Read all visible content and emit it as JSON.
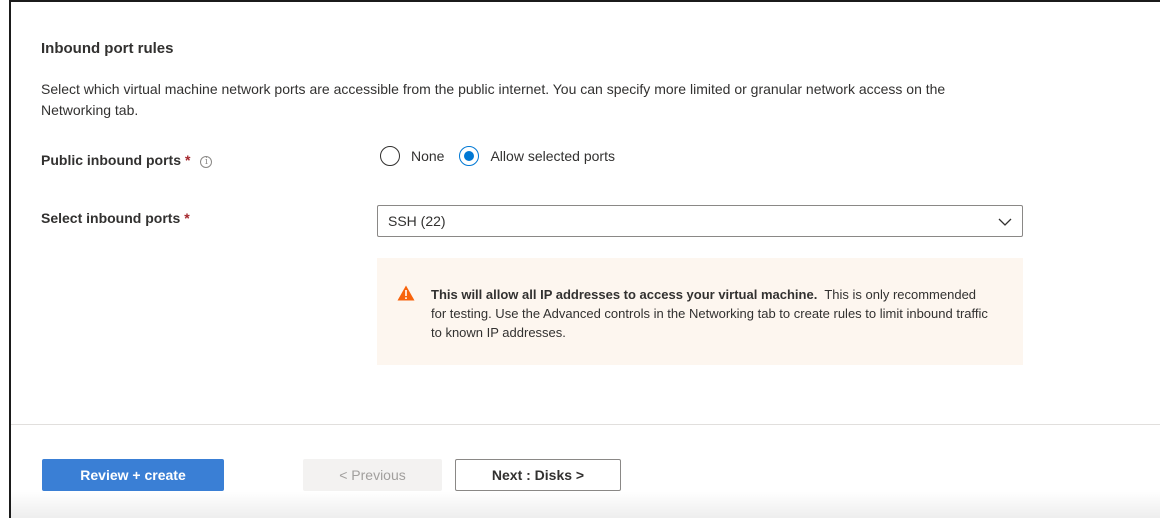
{
  "section": {
    "title": "Inbound port rules",
    "description": "Select which virtual machine network ports are accessible from the public internet. You can specify more limited or granular network access on the Networking tab."
  },
  "public_inbound_ports": {
    "label": "Public inbound ports",
    "required_marker": "*",
    "info_icon": "info-icon",
    "options": [
      {
        "label": "None",
        "selected": false
      },
      {
        "label": "Allow selected ports",
        "selected": true
      }
    ]
  },
  "select_inbound_ports": {
    "label": "Select inbound ports",
    "required_marker": "*",
    "value": "SSH (22)",
    "icon": "chevron-down-icon"
  },
  "warning": {
    "icon": "warning-icon",
    "bold_text": "This will allow all IP addresses to access your virtual machine.",
    "text": "This is only recommended for testing.  Use the Advanced controls in the Networking tab to create rules to limit inbound traffic to known IP addresses.",
    "color": "#fdf6ef",
    "icon_color": "#f7630c"
  },
  "footer": {
    "review_create": "Review + create",
    "previous": "< Previous",
    "next": "Next : Disks >",
    "primary_color": "#3a7fd5"
  }
}
